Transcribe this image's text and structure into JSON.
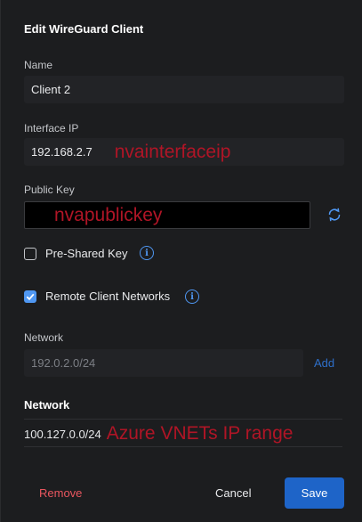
{
  "dialog": {
    "title": "Edit WireGuard Client",
    "name": {
      "label": "Name",
      "value": "Client 2"
    },
    "interface_ip": {
      "label": "Interface IP",
      "value": "192.168.2.7",
      "annotation": "nvainterfaceip"
    },
    "public_key": {
      "label": "Public Key",
      "annotation": "nvapublickey",
      "regenerate_icon": "refresh-icon"
    },
    "pre_shared_key": {
      "label": "Pre-Shared Key",
      "checked": false,
      "info_icon": "info-icon"
    },
    "remote_client_networks": {
      "label": "Remote Client Networks",
      "checked": true,
      "info_icon": "info-icon"
    },
    "network_input": {
      "label": "Network",
      "placeholder": "192.0.2.0/24",
      "add_label": "Add"
    },
    "network_list": {
      "header": "Network",
      "items": [
        "100.127.0.0/24"
      ],
      "annotation": "Azure VNETs IP range"
    },
    "footer": {
      "remove_label": "Remove",
      "cancel_label": "Cancel",
      "save_label": "Save"
    }
  },
  "colors": {
    "accent": "#1e64c8",
    "link": "#4f97f2",
    "danger": "#e9565f",
    "annotation": "#b01526"
  }
}
